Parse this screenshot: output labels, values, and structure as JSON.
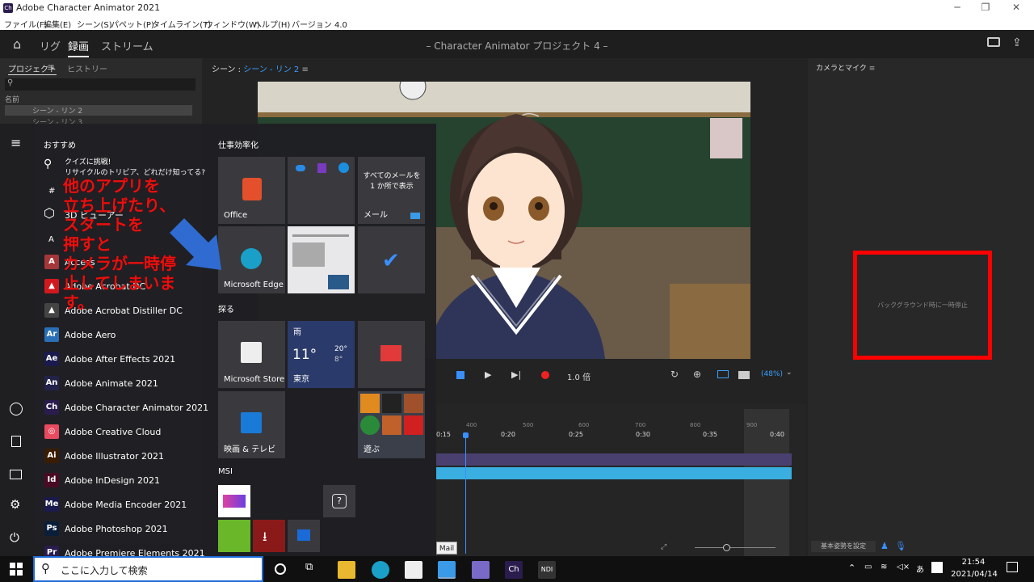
{
  "window": {
    "title": "Adobe Character Animator 2021",
    "app_icon": "Ch"
  },
  "menu": [
    "ファイル(F)",
    "編集(E)",
    "シーン(S)",
    "パペット(P)",
    "タイムライン(T)",
    "ウィンドウ(W)",
    "ヘルプ(H)",
    "バージョン 4.0"
  ],
  "workspace": {
    "tabs": [
      "リグ",
      "録画",
      "ストリーム"
    ],
    "active": "録画",
    "project": "– Character Animator プロジェクト 4 –"
  },
  "left_panel": {
    "tabs": [
      "プロジェクト",
      "ヒストリー"
    ],
    "name_header": "名前",
    "items": [
      "シーン - リン 2",
      "シーン - リン 3"
    ]
  },
  "scene_panel": {
    "label": "シーン :",
    "scene_name": "シーン - リン 2",
    "speed": "1.0 倍",
    "zoom": "(48%)"
  },
  "camera_panel": {
    "title": "カメラとマイク",
    "paused_text": "バックグラウンド時に一時停止",
    "rest_pose": "基本姿勢を設定"
  },
  "timeline": {
    "ticks": [
      "400",
      "500",
      "600",
      "700",
      "800",
      "900"
    ],
    "times": [
      "0:15",
      "0:20",
      "0:25",
      "0:30",
      "0:35",
      "0:40"
    ]
  },
  "start_menu": {
    "recommended": "おすすめ",
    "quiz_title": "クイズに挑戦!",
    "quiz_sub": "リサイクルのトリビア、どれだけ知ってる?",
    "hash": "#",
    "viewer": "3D ビューアー",
    "letter_a": "A",
    "apps": [
      {
        "label": "Access",
        "icon": "A",
        "color": "#a4373a"
      },
      {
        "label": "Adobe Acrobat DC",
        "icon": "▲",
        "color": "#d0191f"
      },
      {
        "label": "Adobe Acrobat Distiller DC",
        "icon": "▲",
        "color": "#444"
      },
      {
        "label": "Adobe Aero",
        "icon": "Ar",
        "color": "#2a6fb5"
      },
      {
        "label": "Adobe After Effects 2021",
        "icon": "Ae",
        "color": "#1a1a4e"
      },
      {
        "label": "Adobe Animate 2021",
        "icon": "An",
        "color": "#22224a"
      },
      {
        "label": "Adobe Character Animator 2021",
        "icon": "Ch",
        "color": "#2b1c4e"
      },
      {
        "label": "Adobe Creative Cloud",
        "icon": "◎",
        "color": "#e84a5f"
      },
      {
        "label": "Adobe Illustrator 2021",
        "icon": "Ai",
        "color": "#3a1c00"
      },
      {
        "label": "Adobe InDesign 2021",
        "icon": "Id",
        "color": "#4a0a24"
      },
      {
        "label": "Adobe Media Encoder 2021",
        "icon": "Me",
        "color": "#1a1a4e"
      },
      {
        "label": "Adobe Photoshop 2021",
        "icon": "Ps",
        "color": "#0a1e3a"
      },
      {
        "label": "Adobe Premiere Elements 2021",
        "icon": "Pr",
        "color": "#2a1c4e"
      }
    ],
    "groups": [
      "仕事効率化",
      "探る",
      "MSI"
    ],
    "tiles": {
      "office": "Office",
      "mail_text": "すべてのメールを 1 か所で表示",
      "mail": "メール",
      "edge": "Microsoft Edge",
      "store": "Microsoft Store",
      "weather_head": "雨",
      "weather_temp": "11°",
      "weather_hi": "20°",
      "weather_lo": "8°",
      "weather_city": "東京",
      "movies": "映画 & テレビ",
      "play": "遊ぶ"
    }
  },
  "annotation": "他のアプリを\n立ち上げたり、\nスタートを\n押すと\nカメラが一時停\n止してしまいま\nす。",
  "taskbar": {
    "search_placeholder": "ここに入力して検索",
    "tooltip": "Mail",
    "time": "21:54",
    "date": "2021/04/14",
    "ch": "Ch",
    "ndi": "NDI"
  }
}
